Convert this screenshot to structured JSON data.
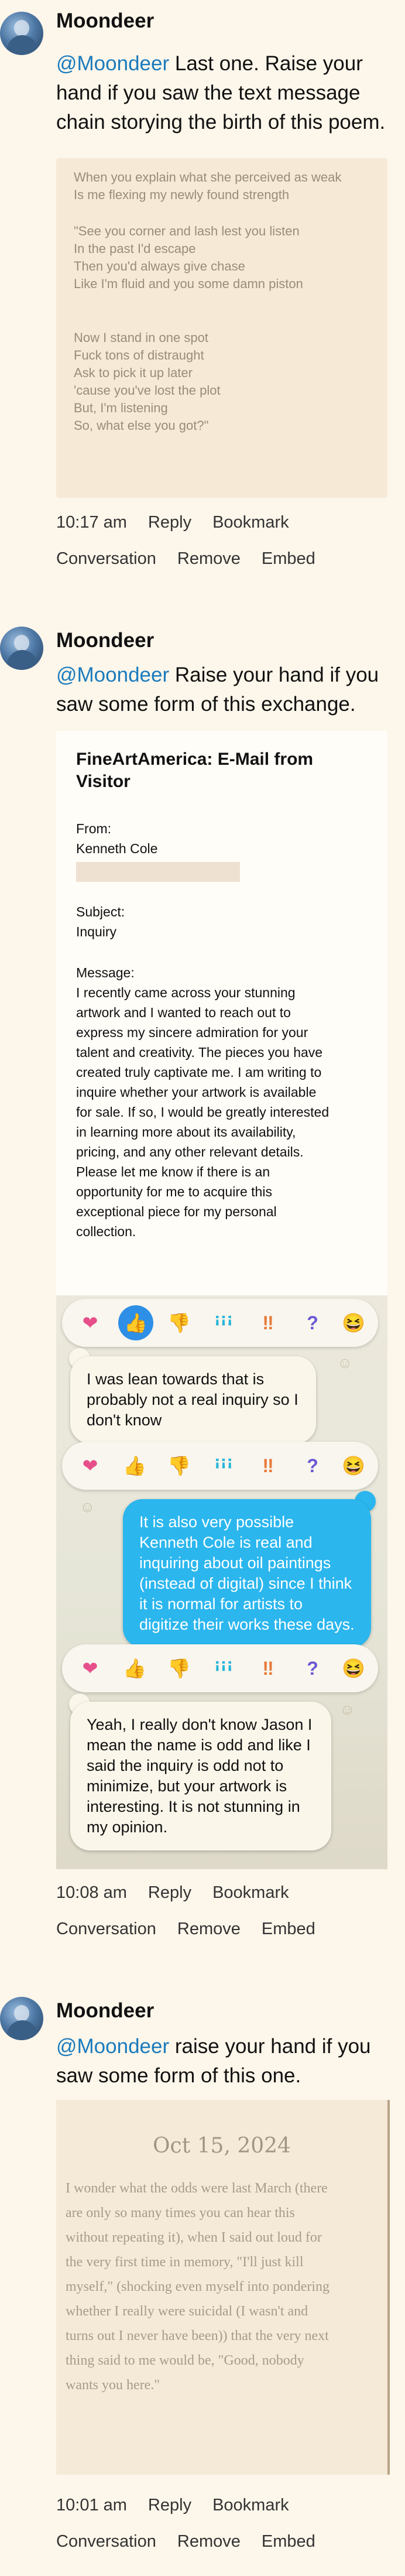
{
  "posts": [
    {
      "author": "Moondeer",
      "mention": "@Moondeer",
      "status_rest": " Last one. Raise your hand if you saw the text message chain storying the birth of this poem.",
      "poem_lines": [
        "When you explain what she perceived as weak",
        "Is me flexing my newly found strength",
        "",
        "\"See you corner and lash lest you listen",
        "In the past I'd escape",
        "Then you'd always give chase",
        "Like I'm fluid and you some damn piston",
        "",
        "",
        "Now I stand in one spot",
        "Fuck tons of distraught",
        "Ask to pick it up later",
        "'cause you've lost the plot",
        "But, I'm listening",
        "So, what else you got?\""
      ],
      "time": "10:17 am",
      "reply": "Reply",
      "bookmark": "Bookmark",
      "conversation": "Conversation",
      "remove": "Remove",
      "embed": "Embed"
    },
    {
      "author": "Moondeer",
      "mention": "@Moondeer",
      "status_rest": " Raise your hand if you saw some form of this exchange.",
      "email": {
        "title": "FineArtAmerica: E-Mail from Visitor",
        "from_label": "From:",
        "from_name": "Kenneth Cole",
        "subject_label": "Subject:",
        "subject": "Inquiry",
        "message_label": "Message:",
        "message_lines": [
          "I recently came across your stunning",
          "artwork and I wanted to reach out to",
          "express my sincere admiration for your",
          "talent and creativity. The pieces you have",
          "created truly captivate me. I am writing to",
          "inquire whether your artwork is available",
          "for sale. If so, I would be greatly interested",
          "in learning more about its availability,",
          "pricing, and any other relevant details.",
          "Please let me know if there is an",
          "opportunity for me to acquire this",
          "exceptional piece for my personal",
          "collection."
        ]
      },
      "chat": {
        "reactions": [
          "heart",
          "thumbs-up",
          "thumbs-down",
          "haha",
          "exclamation",
          "question",
          "laugh-emoji"
        ],
        "reaction_glyphs": [
          "❤",
          "👍",
          "👎",
          "ꜟꜟꜟ",
          "‼",
          "?",
          "😆"
        ],
        "messages": [
          "I was lean towards that is probably not a real inquiry so I don't know",
          "It is also very possible Kenneth Cole is real and inquiring about oil paintings (instead of digital) since I think it is normal for artists to digitize their works these days.",
          "Yeah, I really don't know Jason I mean the name is odd and like I said the inquiry is odd not to minimize, but your artwork is interesting. It is not stunning in my opinion."
        ]
      },
      "time": "10:08 am",
      "reply": "Reply",
      "bookmark": "Bookmark",
      "conversation": "Conversation",
      "remove": "Remove",
      "embed": "Embed"
    },
    {
      "author": "Moondeer",
      "mention": "@Moondeer",
      "status_rest": " raise your hand if you saw some form of this one.",
      "journal": {
        "date": "Oct 15, 2024",
        "lines": [
          "I wonder what the odds were last March (there",
          "are only so many times you can hear this",
          "without repeating it), when I said out loud for",
          "the very first time in memory, \"I'll just kill",
          "myself,\" (shocking even myself into pondering",
          "whether I really were suicidal (I wasn't and",
          "turns out I never have been)) that the very next",
          "thing said to me would be, \"Good, nobody",
          "wants you here.\""
        ]
      },
      "time": "10:01 am",
      "reply": "Reply",
      "bookmark": "Bookmark",
      "conversation": "Conversation",
      "remove": "Remove",
      "embed": "Embed"
    }
  ],
  "colors": {
    "background": "#fdf6ea",
    "mention": "#1a7bbd",
    "card": "#f6ead7",
    "chat_blue": "#2bb6ee",
    "chat_selected": "#2e8fe6"
  }
}
